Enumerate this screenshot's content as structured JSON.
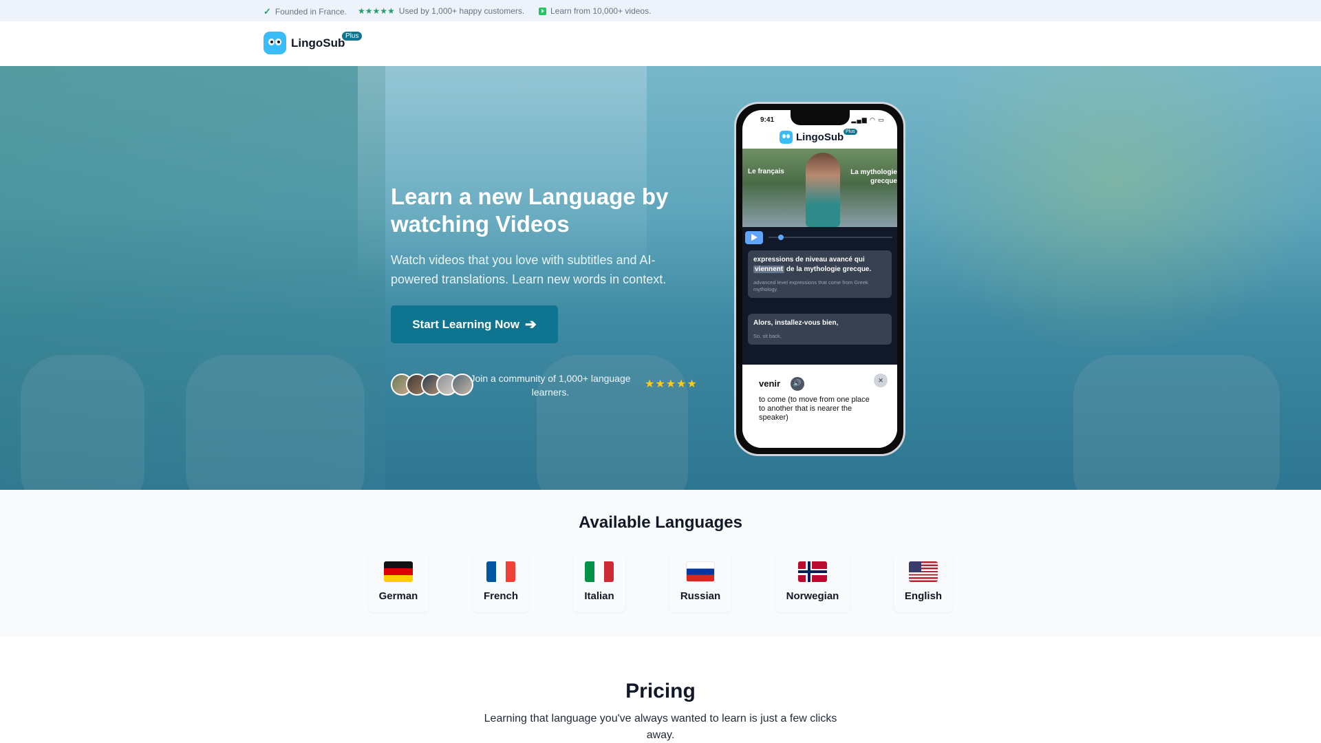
{
  "topbar": {
    "founded": "Founded in France.",
    "customers": "Used by 1,000+ happy customers.",
    "videos": "Learn from 10,000+ videos.",
    "stars": "★★★★★"
  },
  "nav": {
    "brand": "LingoSub",
    "badge": "Plus"
  },
  "hero": {
    "title": "Learn a new Language by watching Videos",
    "subtitle": "Watch videos that you love with subtitles and AI-powered translations. Learn new words in context.",
    "cta_label": "Start Learning Now",
    "cta_icon": "arrow-right-icon",
    "community_text": "Join a community of 1,000+ language learners.",
    "stars": "★★★★★",
    "rating_stars": 5,
    "colors": {
      "cta": "#0e7490",
      "stars": "#facc15"
    }
  },
  "phone": {
    "time": "9:41",
    "status_icons": "▂▄▆ ◠ ▭",
    "app_name": "LingoSub",
    "badge": "Plus",
    "video_label_left": "Le français",
    "video_label_right": "La mythologie grecque",
    "subtitles": [
      {
        "before": "expressions de niveau avancé qui ",
        "highlight": "viennent",
        "after": " de la mythologie grecque.",
        "translation": "advanced level expressions that come from Greek mythology."
      },
      {
        "before": "Alors, installez-vous bien,",
        "highlight": "",
        "after": "",
        "translation": "So, sit back,"
      }
    ],
    "popup": {
      "word": "venir",
      "definition": "to come (to move from one place to another that is nearer the speaker)",
      "close": "×",
      "speaker": "🔊"
    }
  },
  "languages": {
    "title": "Available Languages",
    "items": [
      {
        "name": "German",
        "flag": "germany-flag-icon"
      },
      {
        "name": "French",
        "flag": "france-flag-icon"
      },
      {
        "name": "Italian",
        "flag": "italy-flag-icon"
      },
      {
        "name": "Russian",
        "flag": "russia-flag-icon"
      },
      {
        "name": "Norwegian",
        "flag": "norway-flag-icon"
      },
      {
        "name": "English",
        "flag": "usa-flag-icon"
      }
    ]
  },
  "pricing": {
    "title": "Pricing",
    "subtitle": "Learning that language you've always wanted to learn is just a few clicks away."
  }
}
